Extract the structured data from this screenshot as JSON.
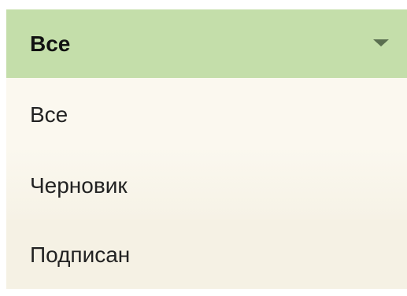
{
  "select": {
    "selected_label": "Все",
    "options": [
      {
        "label": "Все"
      },
      {
        "label": "Черновик"
      },
      {
        "label": "Подписан"
      }
    ]
  },
  "colors": {
    "header_bg": "#c4deaa",
    "options_bg": "#fbf8ef",
    "caret": "#5a6e50"
  },
  "icons": {
    "caret": "caret-down-icon"
  }
}
